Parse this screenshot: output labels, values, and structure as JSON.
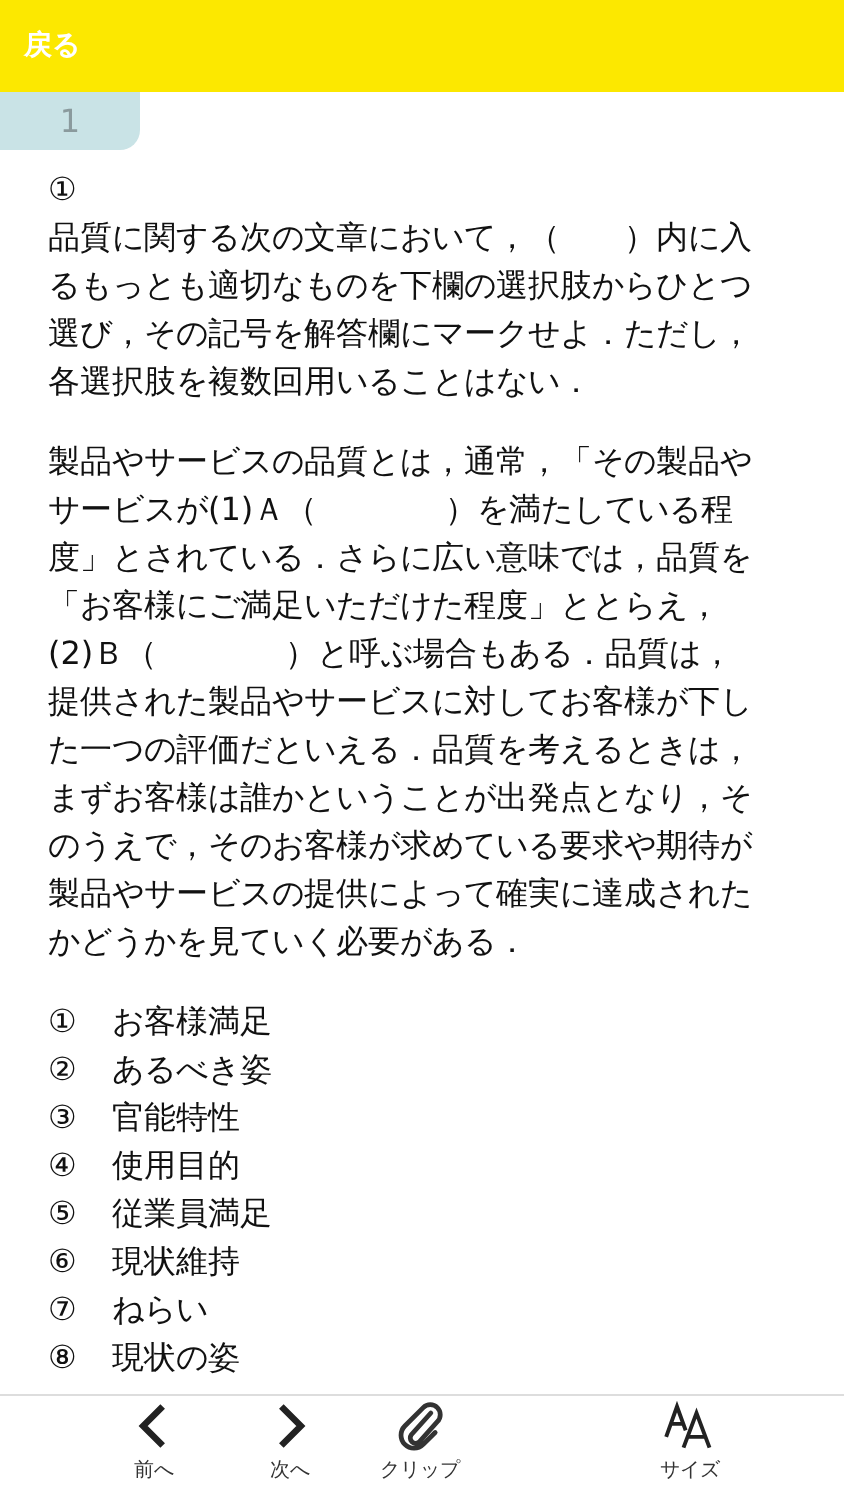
{
  "header": {
    "back_label": "戻る"
  },
  "question_tab": {
    "label": "1"
  },
  "question": {
    "number": "①",
    "instruction": "品質に関する次の文章において，（　　）内に入るもっとも適切なものを下欄の選択肢からひとつ選び，その記号を解答欄にマークせよ．ただし，各選択肢を複数回用いることはない．",
    "passage": "製品やサービスの品質とは，通常，「その製品やサービスが(1)Ａ（　　　　）を満たしている程度」とされている．さらに広い意味では，品質を「お客様にご満足いただけた程度」ととらえ，(2)Ｂ（　　　　）と呼ぶ場合もある．品質は，提供された製品やサービスに対してお客様が下した一つの評価だといえる．品質を考えるときは，まずお客様は誰かということが出発点となり，そのうえで，そのお客様が求めている要求や期待が製品やサービスの提供によって確実に達成されたかどうかを見ていく必要がある．"
  },
  "choices": [
    {
      "number": "①",
      "label": "お客様満足"
    },
    {
      "number": "②",
      "label": "あるべき姿"
    },
    {
      "number": "③",
      "label": "官能特性"
    },
    {
      "number": "④",
      "label": "使用目的"
    },
    {
      "number": "⑤",
      "label": "従業員満足"
    },
    {
      "number": "⑥",
      "label": "現状維持"
    },
    {
      "number": "⑦",
      "label": "ねらい"
    },
    {
      "number": "⑧",
      "label": "現状の姿"
    }
  ],
  "toolbar": [
    {
      "kind": "prev",
      "label": "前へ"
    },
    {
      "kind": "next",
      "label": "次へ"
    },
    {
      "kind": "clip",
      "label": "クリップ"
    },
    {
      "kind": "size",
      "label": "サイズ"
    }
  ]
}
